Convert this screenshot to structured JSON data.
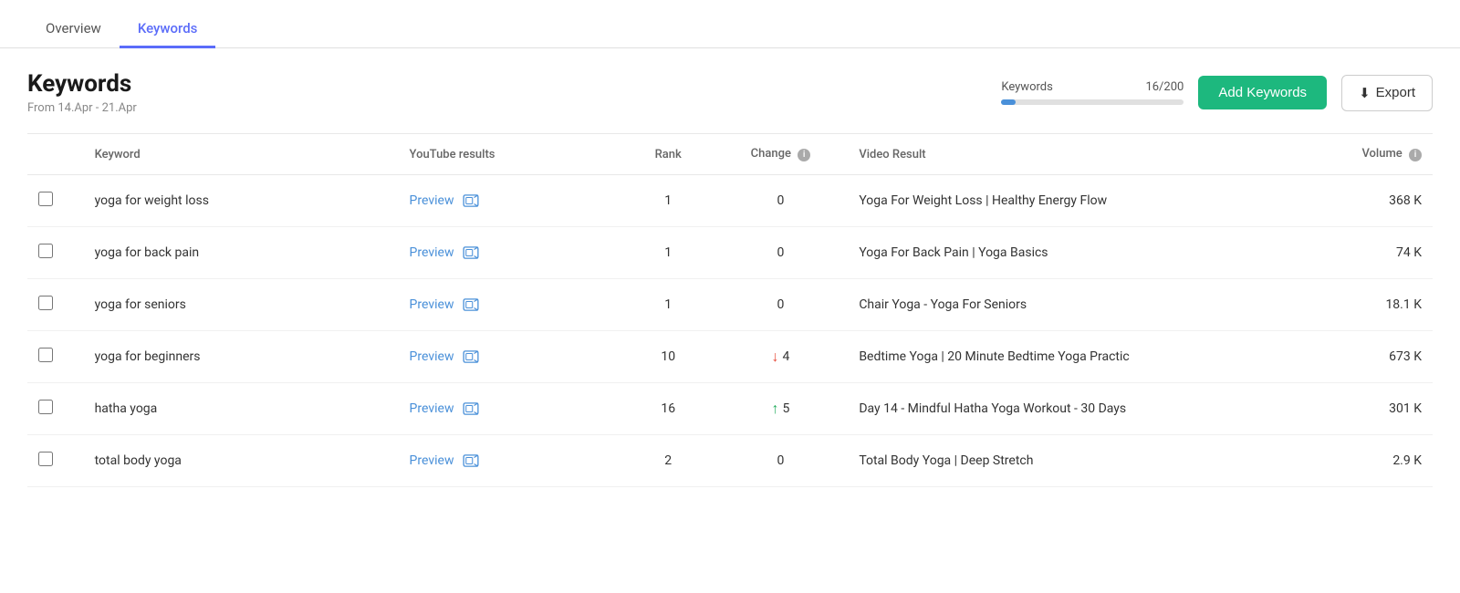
{
  "tabs": [
    {
      "id": "overview",
      "label": "Overview",
      "active": false
    },
    {
      "id": "keywords",
      "label": "Keywords",
      "active": true
    }
  ],
  "header": {
    "title": "Keywords",
    "date_range": "From 14.Apr - 21.Apr",
    "keywords_label": "Keywords",
    "keywords_count": "16/200",
    "keywords_progress_percent": 8,
    "add_button_label": "Add Keywords",
    "export_button_label": "Export"
  },
  "table": {
    "columns": [
      {
        "id": "checkbox",
        "label": ""
      },
      {
        "id": "keyword",
        "label": "Keyword"
      },
      {
        "id": "youtube_results",
        "label": "YouTube results"
      },
      {
        "id": "rank",
        "label": "Rank"
      },
      {
        "id": "change",
        "label": "Change"
      },
      {
        "id": "video_result",
        "label": "Video Result"
      },
      {
        "id": "volume",
        "label": "Volume"
      }
    ],
    "rows": [
      {
        "keyword": "yoga for weight loss",
        "youtube_results_label": "Preview",
        "rank": "1",
        "change_value": "0",
        "change_direction": "none",
        "video_result": "Yoga For Weight Loss | Healthy Energy Flow",
        "volume": "368 K"
      },
      {
        "keyword": "yoga for back pain",
        "youtube_results_label": "Preview",
        "rank": "1",
        "change_value": "0",
        "change_direction": "none",
        "video_result": "Yoga For Back Pain | Yoga Basics",
        "volume": "74 K"
      },
      {
        "keyword": "yoga for seniors",
        "youtube_results_label": "Preview",
        "rank": "1",
        "change_value": "0",
        "change_direction": "none",
        "video_result": "Chair Yoga - Yoga For Seniors",
        "volume": "18.1 K"
      },
      {
        "keyword": "yoga for beginners",
        "youtube_results_label": "Preview",
        "rank": "10",
        "change_value": "4",
        "change_direction": "down",
        "video_result": "Bedtime Yoga | 20 Minute Bedtime Yoga Practic",
        "volume": "673 K"
      },
      {
        "keyword": "hatha yoga",
        "youtube_results_label": "Preview",
        "rank": "16",
        "change_value": "5",
        "change_direction": "up",
        "video_result": "Day 14 - Mindful Hatha Yoga Workout - 30 Days",
        "volume": "301 K"
      },
      {
        "keyword": "total body yoga",
        "youtube_results_label": "Preview",
        "rank": "2",
        "change_value": "0",
        "change_direction": "none",
        "video_result": "Total Body Yoga | Deep Stretch",
        "volume": "2.9 K"
      }
    ]
  }
}
